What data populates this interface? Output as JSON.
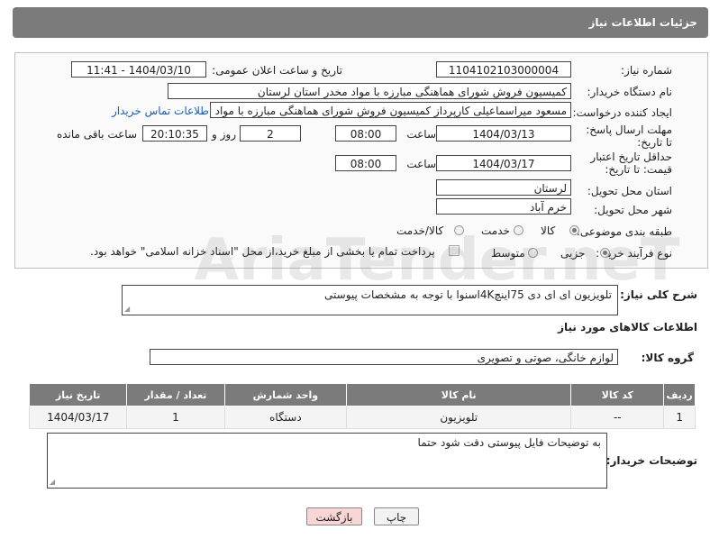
{
  "header": {
    "title": "جزئیات اطلاعات نیاز"
  },
  "form": {
    "need_number_label": "شماره نیاز:",
    "need_number": "1104102103000004",
    "announce_label": "تاریخ و ساعت اعلان عمومی:",
    "announce_value": "1404/03/10 - 11:41",
    "buyer_org_label": "نام دستگاه خریدار:",
    "buyer_org": "کمیسیون فروش شورای هماهنگی مبارزه با مواد مخدر استان لرستان",
    "creator_label": "ایجاد کننده درخواست:",
    "creator": "مسعود میراسماعیلی کارپرداز کمیسیون فروش شورای هماهنگی مبارزه با مواد مخدر استان لرستان",
    "contact_link": "اطلاعات تماس خریدار",
    "reply_deadline_label": "مهلت ارسال پاسخ: تا تاریخ:",
    "reply_date": "1404/03/13",
    "time_label": "ساعت",
    "reply_time": "08:00",
    "days_value": "2",
    "days_label": "روز و",
    "remaining_time": "20:10:35",
    "remaining_label": "ساعت باقی مانده",
    "validity_label": "حداقل تاریخ اعتبار قیمت: تا تاریخ:",
    "validity_date": "1404/03/17",
    "validity_time": "08:00",
    "province_label": "استان محل تحویل:",
    "province": "لرستان",
    "city_label": "شهر محل تحویل:",
    "city": "خرم آباد",
    "category_label": "طبقه بندی موضوعی:",
    "category_options": [
      "کالا",
      "خدمت",
      "کالا/خدمت"
    ],
    "purchase_type_label": "نوع فرآیند خرید :",
    "purchase_options": [
      "جزیی",
      "متوسط"
    ],
    "payment_note": "پرداخت تمام یا بخشی از مبلغ خرید،از محل \"اسناد خزانه اسلامی\" خواهد بود."
  },
  "description": {
    "label": "شرح کلی نیاز:",
    "value": "تلویزیون ای ای دی 75اینچ4Kاسنوا با توجه به مشخصات پیوستی"
  },
  "goods": {
    "section_title": "اطلاعات کالاهای مورد نیاز",
    "group_label": "گروه کالا:",
    "group_value": "لوازم خانگی، صوتی و تصویری",
    "columns": [
      "ردیف",
      "کد کالا",
      "نام کالا",
      "واحد شمارش",
      "تعداد / مقدار",
      "تاریخ نیاز"
    ],
    "rows": [
      {
        "row": "1",
        "code": "--",
        "name": "تلویزیون",
        "unit": "دستگاه",
        "qty": "1",
        "date": "1404/03/17"
      }
    ]
  },
  "buyer_notes": {
    "label": "توضیحات خریدار:",
    "value": "به توضیحات فایل پیوستی دقت شود حتما"
  },
  "buttons": {
    "print": "چاپ",
    "back": "بازگشت"
  },
  "watermark": "AriaTender.neT",
  "colors": {
    "header": "#7b7b7b",
    "link": "#1a5fb4",
    "back_button": "#f9d6d6"
  }
}
